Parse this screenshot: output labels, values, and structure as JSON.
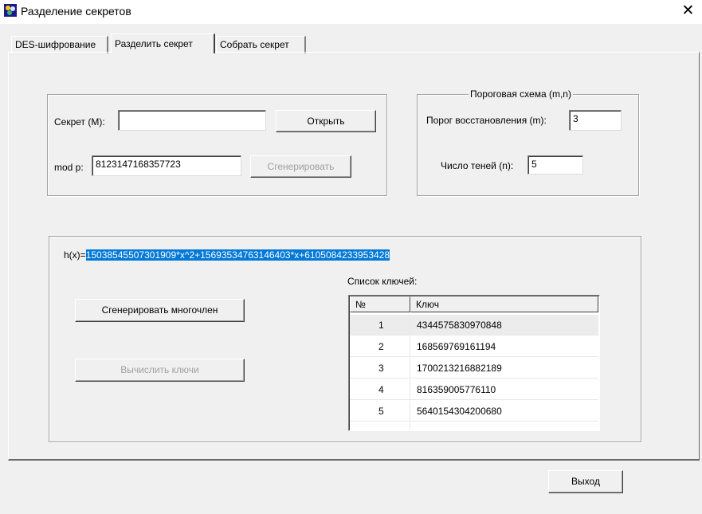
{
  "window": {
    "title": "Разделение секретов",
    "close_glyph": "✕"
  },
  "tabs": [
    {
      "label": "DES-шифрование",
      "active": false
    },
    {
      "label": "Разделить секрет",
      "active": true
    },
    {
      "label": "Собрать секрет",
      "active": false
    }
  ],
  "secret_group": {
    "secret_label": "Секрет (М):",
    "secret_value": "",
    "open_button": "Открыть",
    "mod_label": "mod p:",
    "mod_value": "8123147168357723",
    "generate_button": "Сгенерировать"
  },
  "threshold_group": {
    "title": "Пороговая схема (m,n)",
    "restore_label": "Порог восстановления (m):",
    "restore_value": "3",
    "shadows_label": "Число теней (n):",
    "shadows_value": "5"
  },
  "polynomial": {
    "prefix": "h(x)=",
    "expression": "15038545507301909*x^2+15693534763146403*x+6105084233953428"
  },
  "keys_section": {
    "list_label": "Список ключей:",
    "columns": [
      "№",
      "Ключ"
    ],
    "rows": [
      {
        "index": "1",
        "key": "4344575830970848"
      },
      {
        "index": "2",
        "key": "168569769161194"
      },
      {
        "index": "3",
        "key": "1700213216882189"
      },
      {
        "index": "4",
        "key": "816359005776110"
      },
      {
        "index": "5",
        "key": "5640154304200680"
      }
    ],
    "generate_poly_button": "Сгенерировать многочлен",
    "compute_keys_button": "Вычислить ключи"
  },
  "footer": {
    "exit_button": "Выход"
  },
  "colors": {
    "window_bg": "#f0f0f0",
    "selection": "#0078d7",
    "disabled_text": "#a0a0a0"
  }
}
